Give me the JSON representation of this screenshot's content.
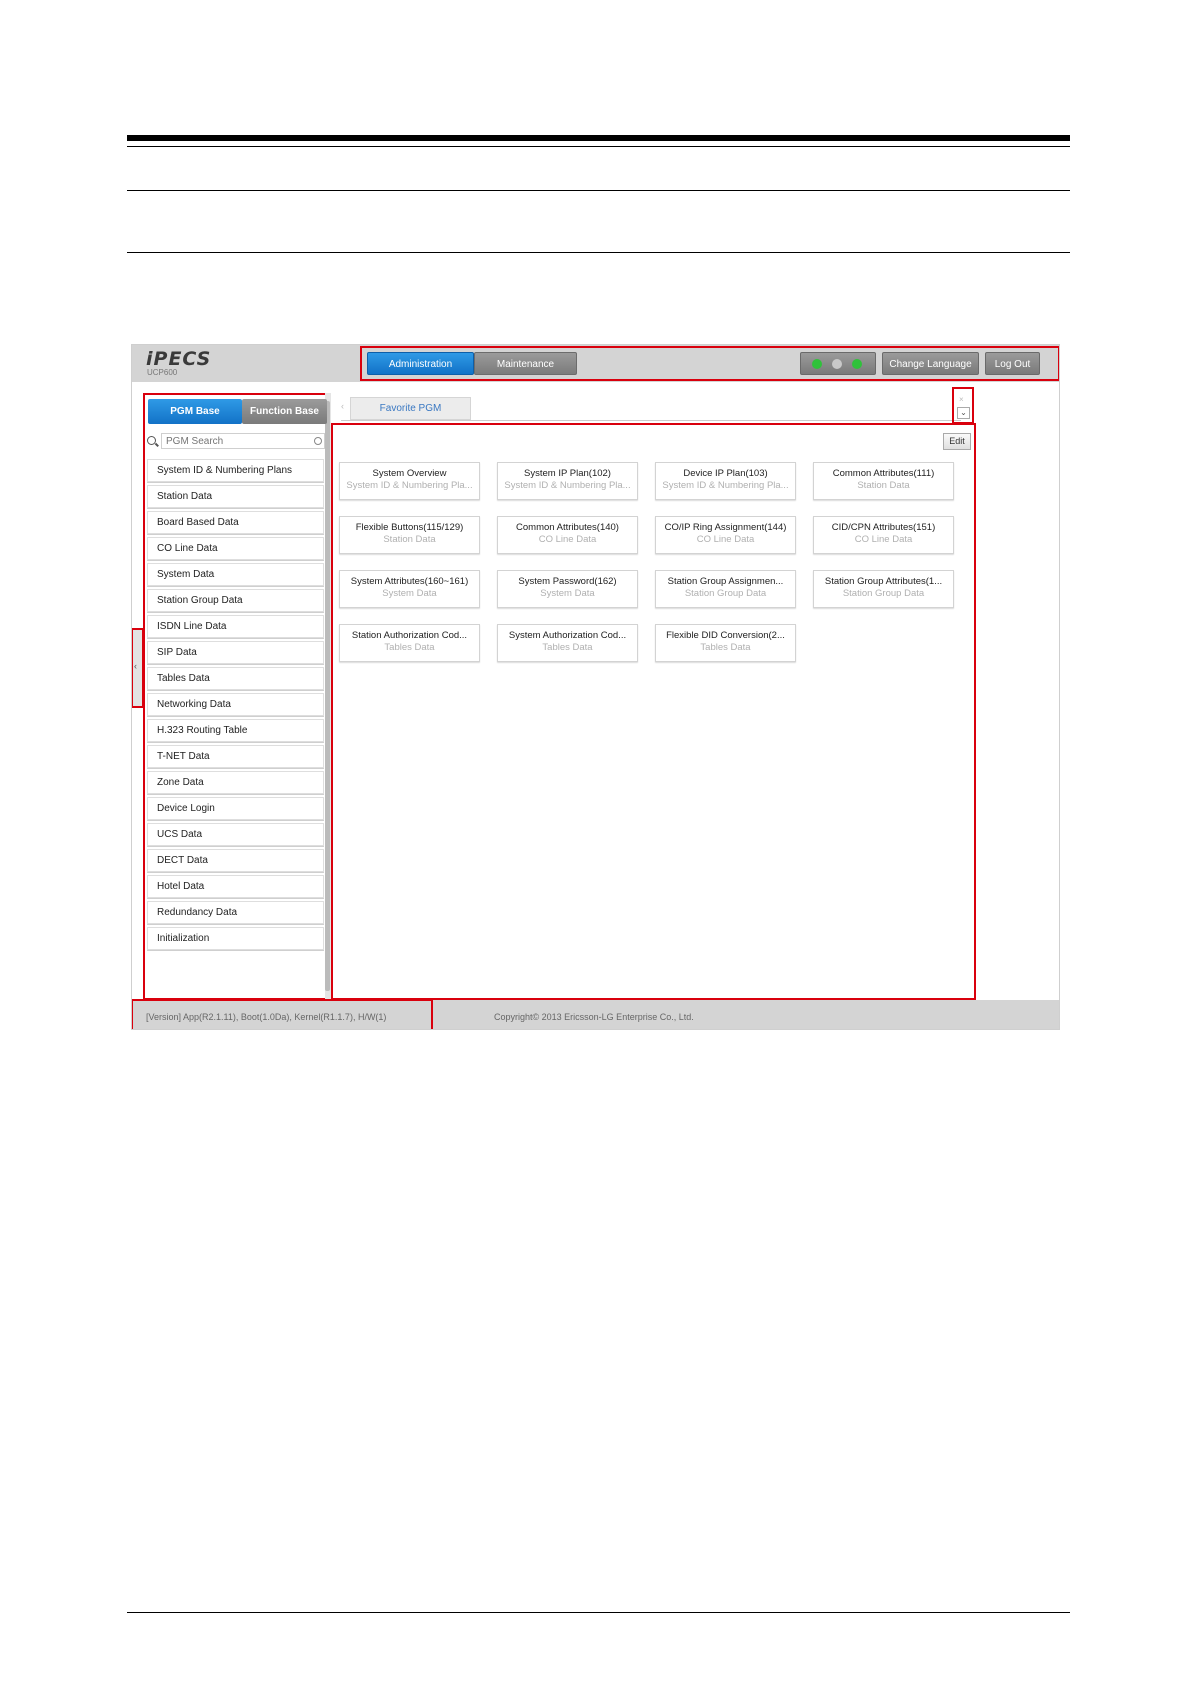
{
  "app": {
    "logo": "iPECS",
    "model": "UCP600"
  },
  "nav": {
    "tabs": [
      {
        "label": "Administration",
        "active": true
      },
      {
        "label": "Maintenance",
        "active": false
      }
    ],
    "status_dots": [
      "#2fc23a",
      "#c9c9c9",
      "#2fc23a"
    ],
    "change_language": "Change Language",
    "log_out": "Log Out"
  },
  "sidebar": {
    "tabs": [
      "PGM Base",
      "Function Base"
    ],
    "search_placeholder": "PGM Search",
    "items": [
      "System ID & Numbering Plans",
      "Station Data",
      "Board Based Data",
      "CO Line Data",
      "System Data",
      "Station Group Data",
      "ISDN Line Data",
      "SIP Data",
      "Tables Data",
      "Networking Data",
      "H.323 Routing Table",
      "T-NET Data",
      "Zone Data",
      "Device Login",
      "UCS Data",
      "DECT Data",
      "Hotel Data",
      "Redundancy Data",
      "Initialization"
    ],
    "collapse_glyph": "‹"
  },
  "main": {
    "tab": "Favorite PGM",
    "edit_label": "Edit",
    "close_glyph": "×",
    "down_glyph": "⌄",
    "prev_glyph": "‹",
    "cards": [
      {
        "title": "System Overview",
        "sub": "System ID & Numbering Pla..."
      },
      {
        "title": "System IP Plan(102)",
        "sub": "System ID & Numbering Pla..."
      },
      {
        "title": "Device IP Plan(103)",
        "sub": "System ID & Numbering Pla..."
      },
      {
        "title": "Common Attributes(111)",
        "sub": "Station Data"
      },
      {
        "title": "Flexible Buttons(115/129)",
        "sub": "Station Data"
      },
      {
        "title": "Common Attributes(140)",
        "sub": "CO Line Data"
      },
      {
        "title": "CO/IP Ring Assignment(144)",
        "sub": "CO Line Data"
      },
      {
        "title": "CID/CPN Attributes(151)",
        "sub": "CO Line Data"
      },
      {
        "title": "System Attributes(160~161)",
        "sub": "System Data"
      },
      {
        "title": "System Password(162)",
        "sub": "System Data"
      },
      {
        "title": "Station Group Assignmen...",
        "sub": "Station Group Data"
      },
      {
        "title": "Station Group Attributes(1...",
        "sub": "Station Group Data"
      },
      {
        "title": "Station Authorization Cod...",
        "sub": "Tables Data"
      },
      {
        "title": "System Authorization Cod...",
        "sub": "Tables Data"
      },
      {
        "title": "Flexible DID Conversion(2...",
        "sub": "Tables Data"
      }
    ]
  },
  "footer": {
    "version": "[Version] App(R2.1.11), Boot(1.0Da), Kernel(R1.1.7), H/W(1)",
    "copyright": "Copyright© 2013 Ericsson-LG Enterprise Co., Ltd."
  },
  "colors": {
    "accent": "#1a82d6",
    "highlight_frame": "#d9000d",
    "bar": "#d4d4d4"
  }
}
